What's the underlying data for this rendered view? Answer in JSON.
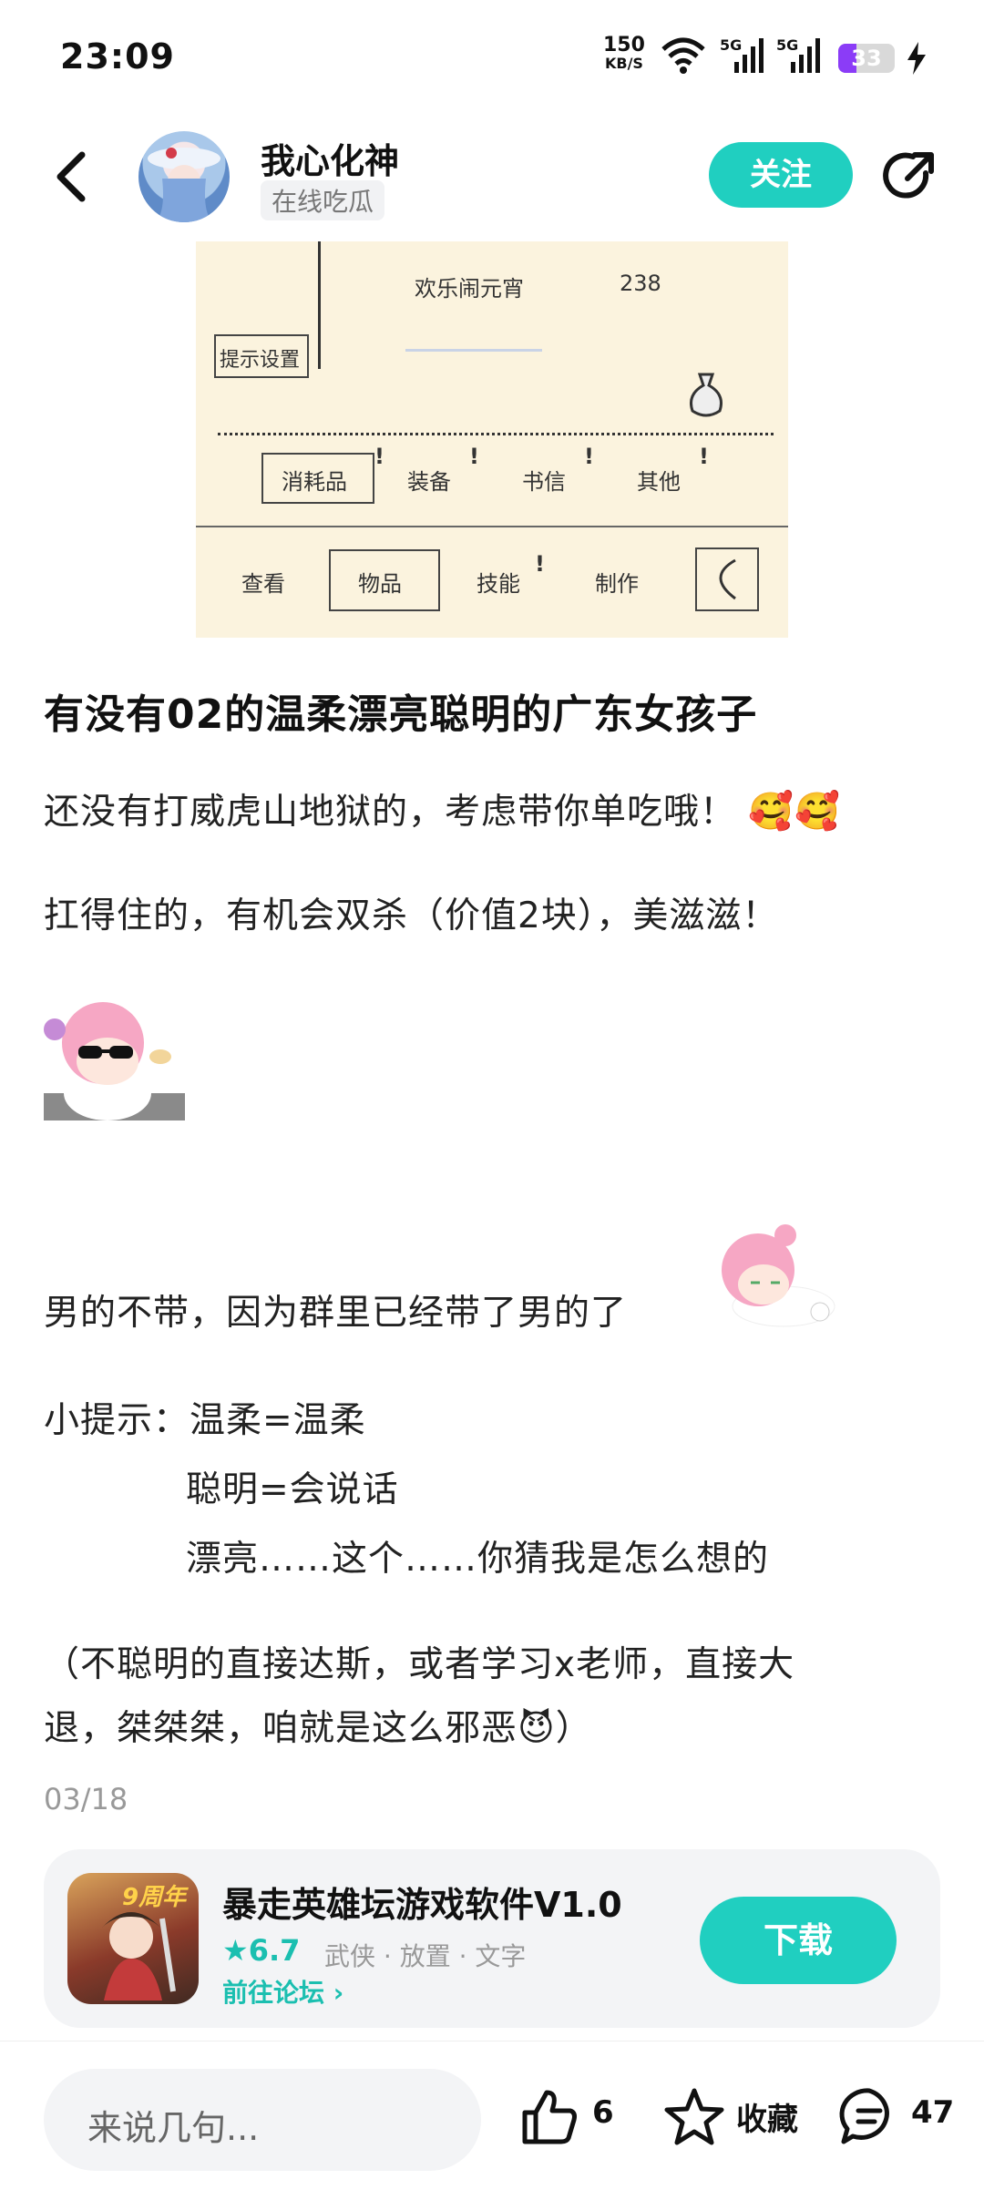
{
  "status_bar": {
    "time": "23:09",
    "net_speed_value": "150",
    "net_speed_unit": "KB/S",
    "signal_1": "5G",
    "signal_2": "5G",
    "battery": "33",
    "battery_level": 0.33,
    "icons": [
      "wifi-icon",
      "signal-icon",
      "signal-icon",
      "battery-icon",
      "charging-icon"
    ]
  },
  "header": {
    "back_icon": "chevron-left-icon",
    "username": "我心化神",
    "user_tag": "在线吃瓜",
    "follow_label": "关注",
    "share_icon": "share-icon"
  },
  "game_screenshot": {
    "event_name": "欢乐闹元宵",
    "event_count": "238",
    "hint_settings": "提示设置",
    "tabs": [
      "消耗品",
      "装备",
      "书信",
      "其他"
    ],
    "nav": [
      "查看",
      "物品",
      "技能",
      "制作"
    ]
  },
  "post": {
    "title": "有没有02的温柔漂亮聪明的广东女孩子",
    "line1": "还没有打威虎山地狱的，考虑带你单吃哦！",
    "line2": "扛得住的，有机会双杀（价值2块），美滋滋！",
    "line3": "男的不带，因为群里已经带了男的了",
    "tip_label": "小提示：温柔=温柔",
    "tip2": "聪明=会说话",
    "tip3": "漂亮……这个……你猜我是怎么想的",
    "line4a": "（不聪明的直接达斯，或者学习x老师，直接大",
    "line4b": "退，桀桀桀，咱就是这么邪恶",
    "line4_end": "）",
    "date": "03/18"
  },
  "app_card": {
    "badge": "9周年",
    "name": "暴走英雄坛游戏软件V1.0",
    "rating": "6.7",
    "categories": "武侠 · 放置 · 文字",
    "forum_link": "前往论坛",
    "download_label": "下载"
  },
  "bottom_bar": {
    "comment_placeholder": "来说几句...",
    "likes": "6",
    "favorite_label": "收藏",
    "comments": "47"
  },
  "colors": {
    "accent": "#20cfc0",
    "battery": "#8b3cf7"
  }
}
